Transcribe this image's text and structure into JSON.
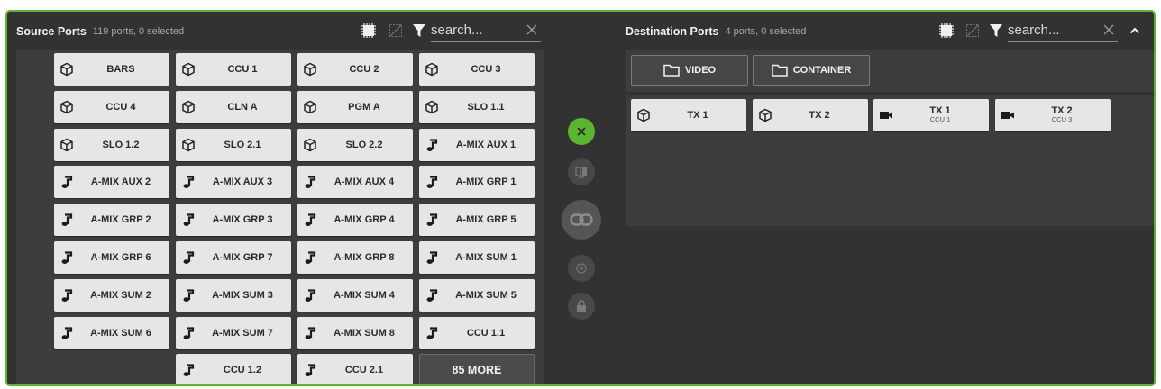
{
  "source": {
    "title": "Source Ports",
    "subtitle": "119 ports, 0 selected",
    "search_placeholder": "search...",
    "more_label": "85 MORE",
    "ports": [
      {
        "label": "BARS",
        "icon": "cube-icon"
      },
      {
        "label": "CCU 1",
        "icon": "cube-icon"
      },
      {
        "label": "CCU 2",
        "icon": "cube-icon"
      },
      {
        "label": "CCU 3",
        "icon": "cube-icon"
      },
      {
        "label": "CCU 4",
        "icon": "cube-icon"
      },
      {
        "label": "CLN A",
        "icon": "cube-icon"
      },
      {
        "label": "PGM A",
        "icon": "cube-icon"
      },
      {
        "label": "SLO 1.1",
        "icon": "cube-icon"
      },
      {
        "label": "SLO 1.2",
        "icon": "cube-icon"
      },
      {
        "label": "SLO 2.1",
        "icon": "cube-icon"
      },
      {
        "label": "SLO 2.2",
        "icon": "cube-icon"
      },
      {
        "label": "A-MIX AUX 1",
        "icon": "music-note-icon"
      },
      {
        "label": "A-MIX AUX 2",
        "icon": "music-note-icon"
      },
      {
        "label": "A-MIX AUX 3",
        "icon": "music-note-icon"
      },
      {
        "label": "A-MIX AUX 4",
        "icon": "music-note-icon"
      },
      {
        "label": "A-MIX GRP 1",
        "icon": "music-note-icon"
      },
      {
        "label": "A-MIX GRP 2",
        "icon": "music-note-icon"
      },
      {
        "label": "A-MIX GRP 3",
        "icon": "music-note-icon"
      },
      {
        "label": "A-MIX GRP 4",
        "icon": "music-note-icon"
      },
      {
        "label": "A-MIX GRP 5",
        "icon": "music-note-icon"
      },
      {
        "label": "A-MIX GRP 6",
        "icon": "music-note-icon"
      },
      {
        "label": "A-MIX GRP 7",
        "icon": "music-note-icon"
      },
      {
        "label": "A-MIX GRP 8",
        "icon": "music-note-icon"
      },
      {
        "label": "A-MIX SUM 1",
        "icon": "music-note-icon"
      },
      {
        "label": "A-MIX SUM 2",
        "icon": "music-note-icon"
      },
      {
        "label": "A-MIX SUM 3",
        "icon": "music-note-icon"
      },
      {
        "label": "A-MIX SUM 4",
        "icon": "music-note-icon"
      },
      {
        "label": "A-MIX SUM 5",
        "icon": "music-note-icon"
      },
      {
        "label": "A-MIX SUM 6",
        "icon": "music-note-icon"
      },
      {
        "label": "A-MIX SUM 7",
        "icon": "music-note-icon"
      },
      {
        "label": "A-MIX SUM 8",
        "icon": "music-note-icon"
      },
      {
        "label": "CCU 1.1",
        "icon": "music-note-icon"
      },
      {
        "label": "CCU 1.2",
        "icon": "music-note-icon"
      },
      {
        "label": "CCU 2.1",
        "icon": "music-note-icon"
      }
    ]
  },
  "destination": {
    "title": "Destination Ports",
    "subtitle": "4 ports, 0 selected",
    "search_placeholder": "search...",
    "folders": [
      {
        "label": "VIDEO",
        "icon": "folder-icon"
      },
      {
        "label": "CONTAINER",
        "icon": "folder-icon"
      }
    ],
    "ports": [
      {
        "label": "TX 1",
        "sub": "",
        "icon": "cube-icon"
      },
      {
        "label": "TX 2",
        "sub": "",
        "icon": "cube-icon"
      },
      {
        "label": "TX 1",
        "sub": "CCU 1",
        "icon": "video-camera-icon"
      },
      {
        "label": "TX 2",
        "sub": "CCU 3",
        "icon": "video-camera-icon"
      }
    ]
  },
  "controls": {
    "clear_icon": "close-icon",
    "swap_icon": "swap-icon",
    "link_icon": "link-icon",
    "target_icon": "target-icon",
    "lock_icon": "lock-icon"
  },
  "colors": {
    "accent": "#5cb531",
    "panel_bg": "#323232",
    "area_bg": "#3d3d3d",
    "port_bg": "#e6e6e6"
  }
}
